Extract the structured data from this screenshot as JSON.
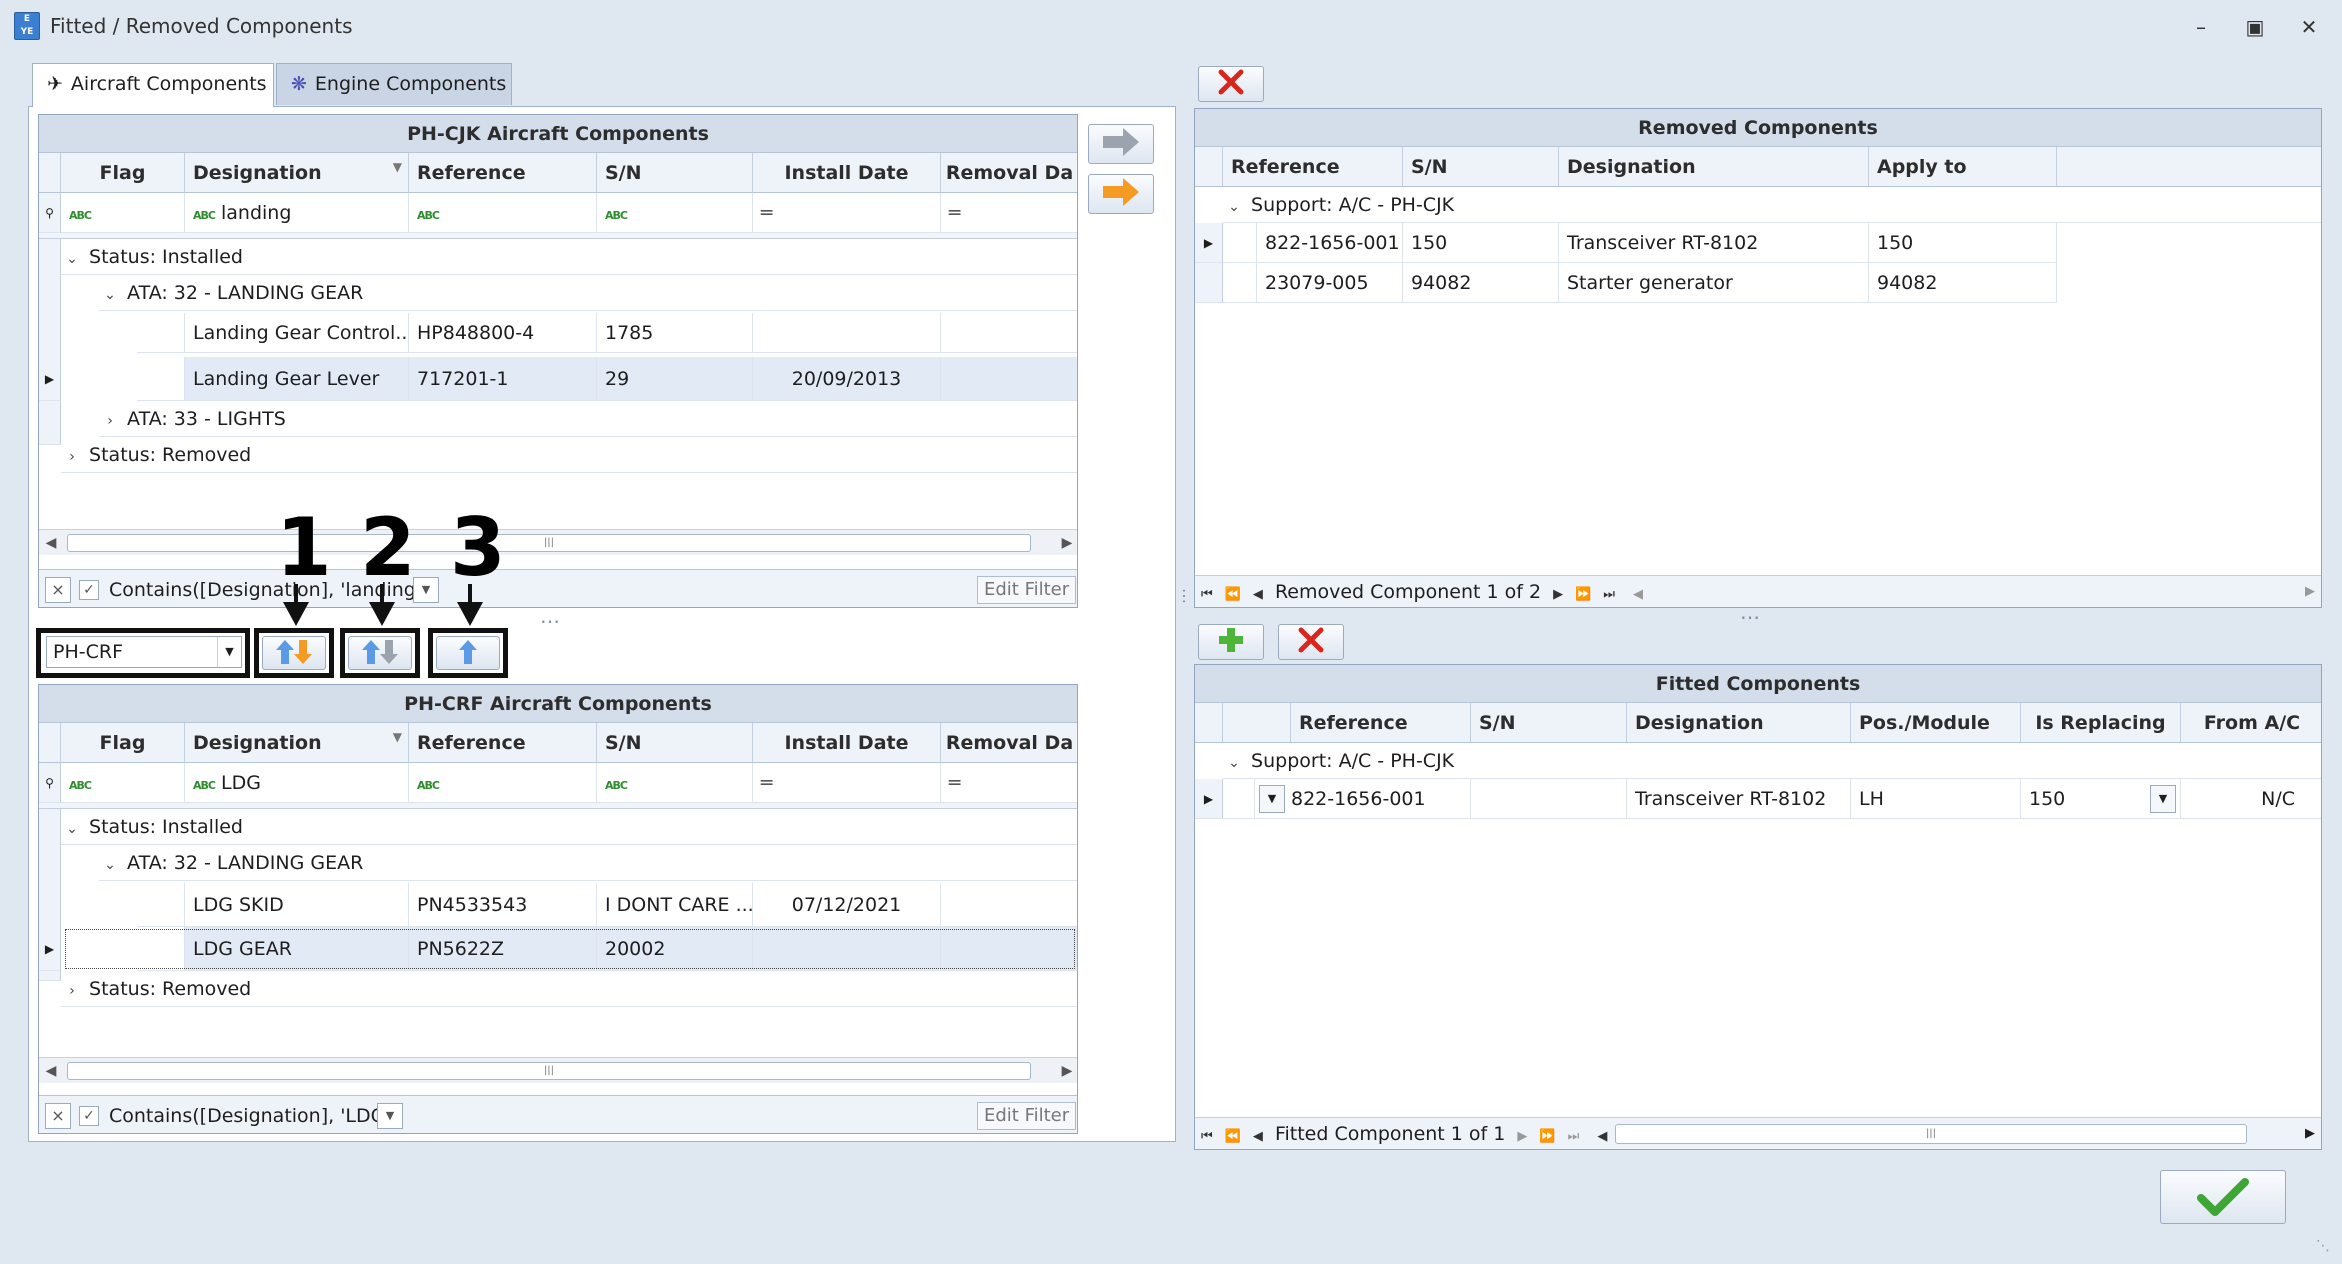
{
  "window": {
    "title": "Fitted / Removed Components",
    "icon_text": "E\nYE"
  },
  "tabs": [
    {
      "label": "Aircraft Components"
    },
    {
      "label": "Engine Components"
    }
  ],
  "top_grid": {
    "caption": "PH-CJK Aircraft Components",
    "columns": [
      "Flag",
      "Designation",
      "Reference",
      "S/N",
      "Install Date",
      "Removal Da"
    ],
    "filter_row": {
      "designation": "landing"
    },
    "groups": {
      "installed": "Status: Installed",
      "ata32": "ATA: 32 - LANDING GEAR",
      "ata33": "ATA: 33 - LIGHTS",
      "removed": "Status: Removed"
    },
    "rows": [
      {
        "designation": "Landing Gear Control...",
        "reference": "HP848800-4",
        "sn": "1785",
        "install_date": "",
        "removal_date": ""
      },
      {
        "designation": "Landing Gear Lever",
        "reference": "717201-1",
        "sn": "29",
        "install_date": "20/09/2013",
        "removal_date": ""
      }
    ],
    "filter_text": "Contains([Designation], 'landing')",
    "edit_filter": "Edit Filter"
  },
  "aircraft_select": {
    "value": "PH-CRF"
  },
  "bottom_grid": {
    "caption": "PH-CRF Aircraft Components",
    "columns": [
      "Flag",
      "Designation",
      "Reference",
      "S/N",
      "Install Date",
      "Removal Da"
    ],
    "filter_row": {
      "designation": "LDG"
    },
    "groups": {
      "installed": "Status: Installed",
      "ata32": "ATA: 32 - LANDING GEAR",
      "removed": "Status: Removed"
    },
    "rows": [
      {
        "designation": "LDG SKID",
        "reference": "PN4533543",
        "sn": "I DONT CARE ...",
        "install_date": "07/12/2021",
        "removal_date": ""
      },
      {
        "designation": "LDG GEAR",
        "reference": "PN5622Z",
        "sn": "20002",
        "install_date": "",
        "removal_date": ""
      }
    ],
    "filter_text": "Contains([Designation], 'LDG')",
    "edit_filter": "Edit Filter"
  },
  "removed_grid": {
    "caption": "Removed Components",
    "columns": [
      "Reference",
      "S/N",
      "Designation",
      "Apply to"
    ],
    "group": "Support: A/C - PH-CJK",
    "rows": [
      {
        "reference": "822-1656-001",
        "sn": "150",
        "designation": "Transceiver RT-8102",
        "apply_to": "150"
      },
      {
        "reference": "23079-005",
        "sn": "94082",
        "designation": "Starter generator",
        "apply_to": "94082"
      }
    ],
    "nav_text": "Removed Component 1 of 2"
  },
  "fitted_grid": {
    "caption": "Fitted Components",
    "columns": [
      "Reference",
      "S/N",
      "Designation",
      "Pos./Module",
      "Is Replacing",
      "From A/C"
    ],
    "group": "Support: A/C - PH-CJK",
    "rows": [
      {
        "reference": "822-1656-001",
        "sn": "",
        "designation": "Transceiver RT-8102",
        "pos_module": "LH",
        "is_replacing": "150",
        "from_ac": "N/C"
      }
    ],
    "nav_text": "Fitted Component 1 of 1"
  },
  "annotations": [
    "1",
    "2",
    "3"
  ],
  "colors": {
    "accent_orange": "#f59a23",
    "delete_red": "#d9261c",
    "ok_green": "#3fa535",
    "header_blue": "#d4deea"
  }
}
